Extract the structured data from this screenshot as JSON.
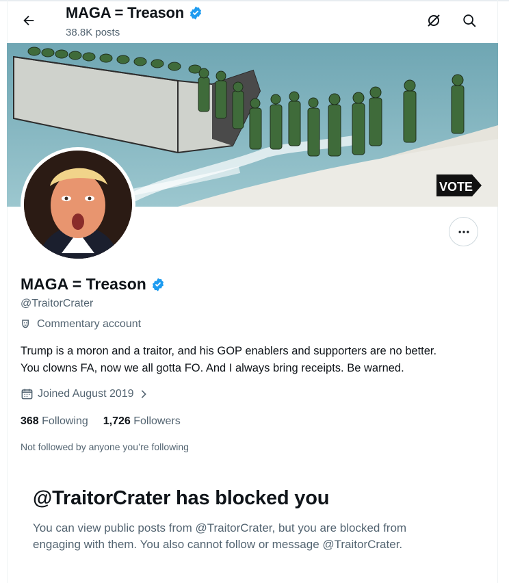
{
  "header": {
    "title": "MAGA = Treason",
    "posts": "38.8K posts",
    "back_icon": "arrow-left-icon",
    "grok_icon": "grok-icon",
    "search_icon": "search-icon"
  },
  "banner": {
    "vote_sign": "VOTE"
  },
  "profile": {
    "name": "MAGA = Treason",
    "handle": "@TraitorCrater",
    "category": "Commentary account",
    "bio_line1": "Trump is a moron and a traitor, and his GOP enablers and supporters are no better.",
    "bio_line2": "You clowns FA, now we all gotta FO. And I always bring receipts. Be warned.",
    "joined": "Joined August 2019",
    "following_count": "368",
    "following_label": "Following",
    "followers_count": "1,726",
    "followers_label": "Followers",
    "not_followed": "Not followed by anyone you’re following"
  },
  "blocked": {
    "title": "@TraitorCrater has blocked you",
    "line1": "You can view public posts from @TraitorCrater, but you are blocked from",
    "line2": "engaging with them. You also cannot follow or message @TraitorCrater."
  },
  "colors": {
    "verified": "#1d9bf0",
    "text_primary": "#0f1419",
    "text_secondary": "#536471"
  }
}
